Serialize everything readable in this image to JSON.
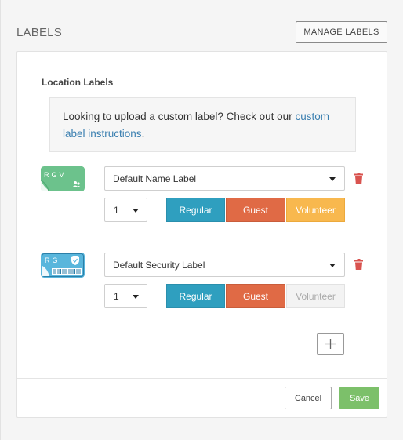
{
  "header": {
    "title": "LABELS",
    "manage_button": "MANAGE LABELS"
  },
  "section": {
    "title": "Location Labels"
  },
  "info": {
    "text": "Looking to upload a custom label? Check out our ",
    "link_text": "custom label instructions",
    "suffix": "."
  },
  "labels": [
    {
      "icon": "name-label-icon",
      "icon_text": "RGV",
      "icon_color": "#6cc28c",
      "selected": "Default Name Label",
      "quantity": "1",
      "types": {
        "regular": "Regular",
        "guest": "Guest",
        "volunteer": "Volunteer"
      },
      "volunteer_active": true
    },
    {
      "icon": "security-label-icon",
      "icon_text": "RG",
      "icon_color": "#59b6dc",
      "selected": "Default Security Label",
      "quantity": "1",
      "types": {
        "regular": "Regular",
        "guest": "Guest",
        "volunteer": "Volunteer"
      },
      "volunteer_active": false
    }
  ],
  "footer": {
    "cancel": "Cancel",
    "save": "Save"
  },
  "colors": {
    "regular": "#2f9fbf",
    "guest": "#e06a45",
    "volunteer": "#f8b84e",
    "save": "#7cc06a",
    "trash": "#d9534f",
    "link": "#3a7fb0"
  }
}
